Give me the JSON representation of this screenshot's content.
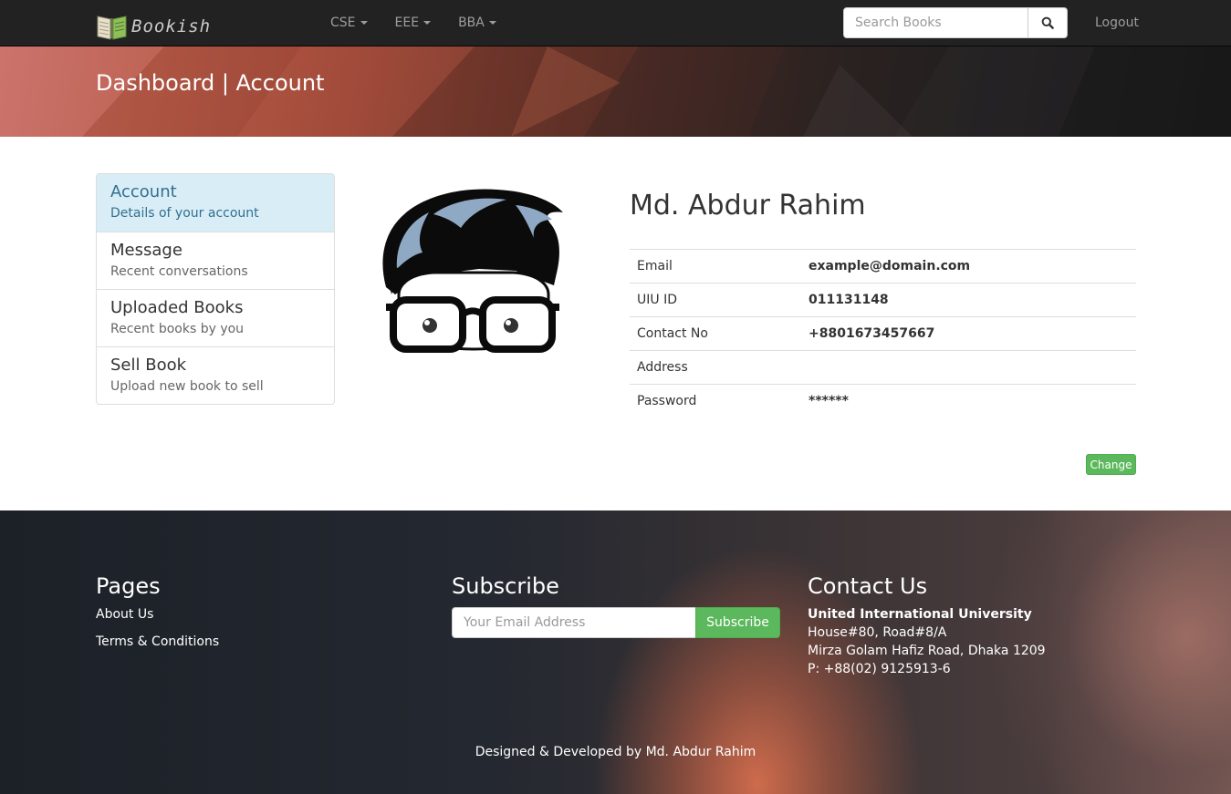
{
  "navbar": {
    "brand": "Bookish",
    "menu": [
      {
        "label": "CSE"
      },
      {
        "label": "EEE"
      },
      {
        "label": "BBA"
      }
    ],
    "search_placeholder": "Search Books",
    "logout": "Logout"
  },
  "hero": {
    "title": "Dashboard | Account"
  },
  "sidebar": {
    "items": [
      {
        "title": "Account",
        "subtitle": "Details of your account",
        "active": true
      },
      {
        "title": "Message",
        "subtitle": "Recent conversations"
      },
      {
        "title": "Uploaded Books",
        "subtitle": "Recent books by you"
      },
      {
        "title": "Sell Book",
        "subtitle": "Upload new book to sell"
      }
    ]
  },
  "profile": {
    "name": "Md. Abdur Rahim",
    "fields": [
      {
        "label": "Email",
        "value": "example@domain.com"
      },
      {
        "label": "UIU ID",
        "value": "011131148"
      },
      {
        "label": "Contact No",
        "value": "+8801673457667"
      },
      {
        "label": "Address",
        "value": ""
      },
      {
        "label": "Password",
        "value": "******"
      }
    ],
    "change_label": "Change"
  },
  "footer": {
    "pages_title": "Pages",
    "links": [
      "About Us",
      "Terms & Conditions"
    ],
    "subscribe_title": "Subscribe",
    "subscribe_placeholder": "Your Email Address",
    "subscribe_button": "Subscribe",
    "contact_title": "Contact Us",
    "contact_lines": [
      "United International University",
      "House#80, Road#8/A",
      "Mirza Golam Hafiz Road, Dhaka 1209",
      "P: +88(02) 9125913-6"
    ],
    "credit": "Designed & Developed by Md. Abdur Rahim"
  },
  "colors": {
    "navbar_bg": "#222222",
    "accent_green": "#5cb85c",
    "active_item_bg": "#d9edf7",
    "active_item_text": "#31708f"
  },
  "icons": [
    "book-logo-icon",
    "caret-down-icon",
    "search-icon",
    "avatar-nerd-icon"
  ]
}
